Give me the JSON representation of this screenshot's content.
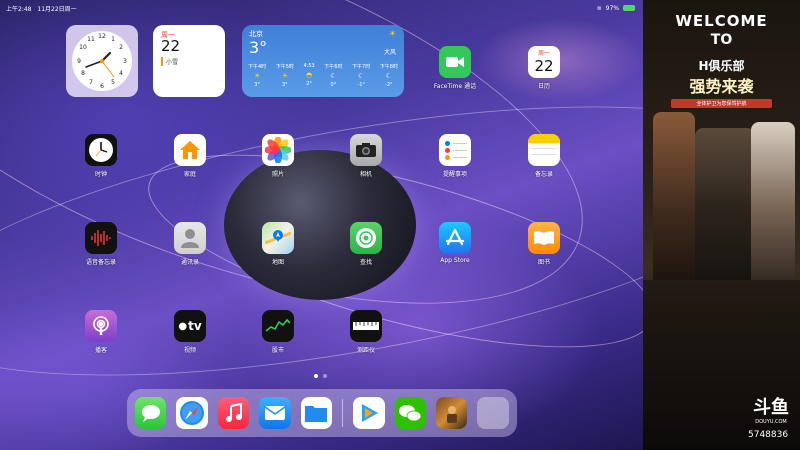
{
  "status": {
    "time": "上午2:48",
    "date": "11月22日周一",
    "battery": "97%"
  },
  "widgets": {
    "calendar": {
      "weekday": "周一",
      "day": "22",
      "event": "小雪"
    },
    "weather": {
      "city": "北京",
      "temp": "3°",
      "condition": "大风",
      "hours": [
        {
          "time": "下午4时",
          "icon": "sun-icon",
          "temp": "3°"
        },
        {
          "time": "下午5时",
          "icon": "sun-icon",
          "temp": "3°"
        },
        {
          "time": "4:53",
          "icon": "sunset-icon",
          "temp": "2°"
        },
        {
          "time": "下午6时",
          "icon": "moon-icon",
          "temp": "0°"
        },
        {
          "time": "下午7时",
          "icon": "moon-icon",
          "temp": "-1°"
        },
        {
          "time": "下午8时",
          "icon": "moon-icon",
          "temp": "-2°"
        }
      ]
    }
  },
  "apps": {
    "facetime": "FaceTime 通话",
    "calendar": "日历",
    "calendar_weekday": "周一",
    "calendar_day": "22",
    "clock": "时钟",
    "home": "家庭",
    "photos": "照片",
    "camera": "相机",
    "reminders": "提醒事项",
    "notes": "备忘录",
    "voice_memos": "语音备忘录",
    "contacts": "通讯录",
    "maps": "地图",
    "findmy": "查找",
    "appstore": "App Store",
    "books": "图书",
    "podcasts": "播客",
    "tv": "视频",
    "tv_icon_text": "tv",
    "stocks": "股市",
    "measure": "测距仪"
  },
  "dock": [
    "messages-icon",
    "safari-icon",
    "music-icon",
    "mail-icon",
    "files-icon",
    "tencent-video-icon",
    "wechat-icon",
    "game-icon",
    "app-library-icon"
  ],
  "sidebar": {
    "welcome": "WELCOME",
    "to": "TO",
    "club": "H俱乐部",
    "strong": "强势来袭",
    "subtitle": "全体护卫为您保驾护航",
    "logo": "斗鱼",
    "logo_sub": "DOUYU.COM",
    "room_id": "5748836"
  },
  "colors": {
    "facetime": "#34c759",
    "appstore": "#1e90ff",
    "books": "#ff9500",
    "podcasts": "#9b59d0",
    "maps": "#34c759",
    "red": "#ff3b30"
  }
}
